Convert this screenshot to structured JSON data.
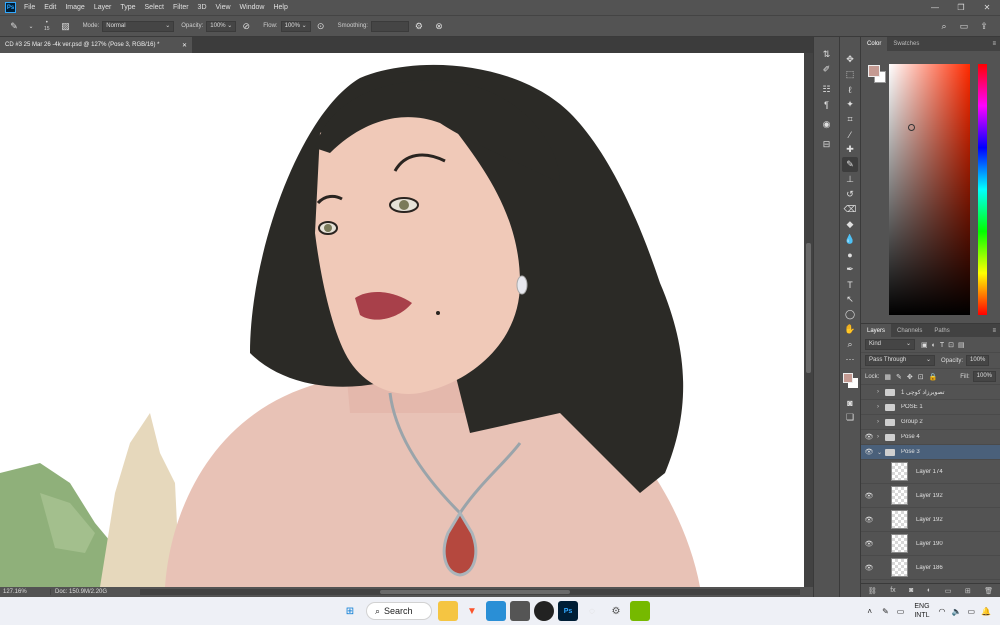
{
  "menubar": {
    "logo": "Ps",
    "items": [
      "File",
      "Edit",
      "Image",
      "Layer",
      "Type",
      "Select",
      "Filter",
      "3D",
      "View",
      "Window",
      "Help"
    ]
  },
  "options": {
    "brush_size": "15",
    "mode_label": "Mode:",
    "mode_value": "Normal",
    "opacity_label": "Opacity:",
    "opacity_value": "100%",
    "flow_label": "Flow:",
    "flow_value": "100%",
    "smoothing_label": "Smoothing:"
  },
  "document": {
    "tab_title": "CD #3 25 Mar 26 -4k ver.psd @ 127% (Pose 3, RGB/16) *"
  },
  "status": {
    "zoom": "127.16%",
    "doc_info": "Doc: 150.9M/2.20G"
  },
  "color_panel": {
    "tabs": [
      "Color",
      "Swatches"
    ],
    "foreground_color": "#c49a92",
    "background_color": "#ffffff"
  },
  "layers_panel": {
    "tabs": [
      "Layers",
      "Channels",
      "Paths"
    ],
    "filter_kind": "Kind",
    "blend_mode": "Pass Through",
    "opacity_label": "Opacity:",
    "opacity_value": "100%",
    "lock_label": "Lock:",
    "fill_label": "Fill:",
    "fill_value": "100%",
    "layers": [
      {
        "name": "تصویرزاد کوچی 1",
        "type": "group"
      },
      {
        "name": "POSE 1",
        "type": "group"
      },
      {
        "name": "Group 2",
        "type": "group"
      },
      {
        "name": "Pose 4",
        "type": "group"
      },
      {
        "name": "Pose 3",
        "type": "group"
      },
      {
        "name": "Layer 174",
        "type": "layer"
      },
      {
        "name": "Layer 192",
        "type": "layer"
      },
      {
        "name": "Layer 192",
        "type": "layer"
      },
      {
        "name": "Layer 190",
        "type": "layer"
      },
      {
        "name": "Layer 186",
        "type": "layer"
      }
    ]
  },
  "taskbar": {
    "search_label": "Search",
    "lang_line1": "ENG",
    "lang_line2": "INTL"
  }
}
